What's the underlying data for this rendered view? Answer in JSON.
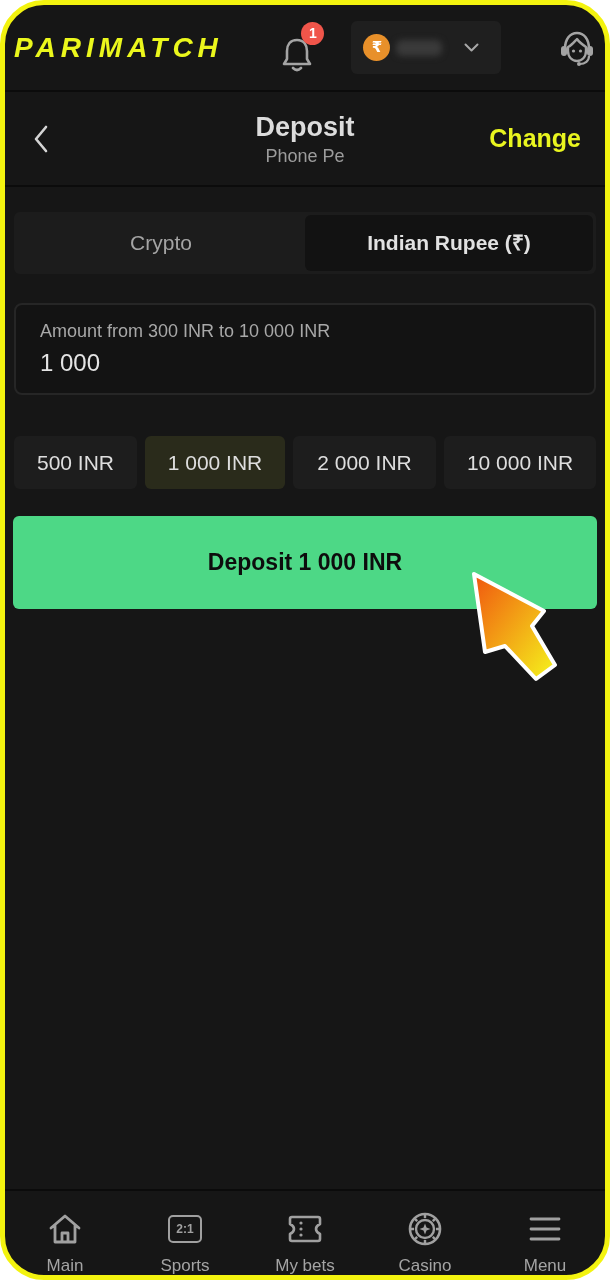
{
  "header": {
    "logo": "PARIMATCH",
    "notifications": {
      "count": "1"
    },
    "balance": {
      "currency_symbol": "₹"
    }
  },
  "title_bar": {
    "title": "Deposit",
    "subtitle": "Phone Pe",
    "action": "Change"
  },
  "tabs": [
    {
      "label": "Crypto",
      "selected": false
    },
    {
      "label": "Indian Rupee (₹)",
      "selected": true
    }
  ],
  "amount_field": {
    "label": "Amount from 300 INR to 10 000 INR",
    "value": "1 000"
  },
  "quick_amounts": [
    {
      "label": "500 INR",
      "selected": false
    },
    {
      "label": "1 000 INR",
      "selected": true
    },
    {
      "label": "2 000 INR",
      "selected": false
    },
    {
      "label": "10 000 INR",
      "selected": false
    }
  ],
  "deposit_button": {
    "label": "Deposit 1 000 INR"
  },
  "bottom_nav": [
    {
      "label": "Main"
    },
    {
      "label": "Sports",
      "icon_text": "2:1"
    },
    {
      "label": "My bets"
    },
    {
      "label": "Casino"
    },
    {
      "label": "Menu"
    }
  ]
}
